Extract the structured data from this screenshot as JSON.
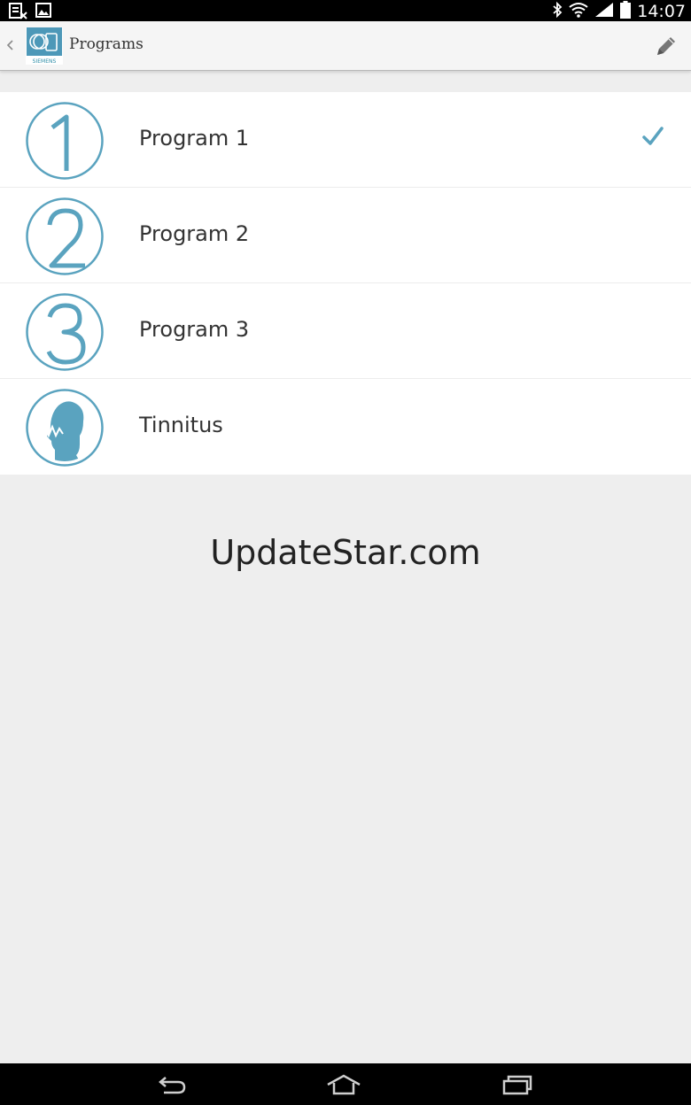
{
  "status_bar": {
    "time": "14:07",
    "left_icons": [
      "screenshot-icon",
      "image-icon"
    ],
    "right_icons": [
      "bluetooth-icon",
      "wifi-icon",
      "signal-icon",
      "battery-icon"
    ]
  },
  "action_bar": {
    "title": "Programs",
    "logo_text": "SIEMENS",
    "back_icon": "back-chevron-icon",
    "edit_icon": "pencil-icon"
  },
  "programs": [
    {
      "label": "Program 1",
      "icon": "number-1-icon",
      "selected": true
    },
    {
      "label": "Program 2",
      "icon": "number-2-icon",
      "selected": false
    },
    {
      "label": "Program 3",
      "icon": "number-3-icon",
      "selected": false
    },
    {
      "label": "Tinnitus",
      "icon": "tinnitus-head-icon",
      "selected": false
    }
  ],
  "watermark": "UpdateStar.com",
  "nav_bar": {
    "icons": [
      "back-icon",
      "home-icon",
      "recent-apps-icon"
    ]
  },
  "colors": {
    "accent": "#5aa3bf",
    "list_background": "#ffffff",
    "page_background": "#eeeeee"
  }
}
